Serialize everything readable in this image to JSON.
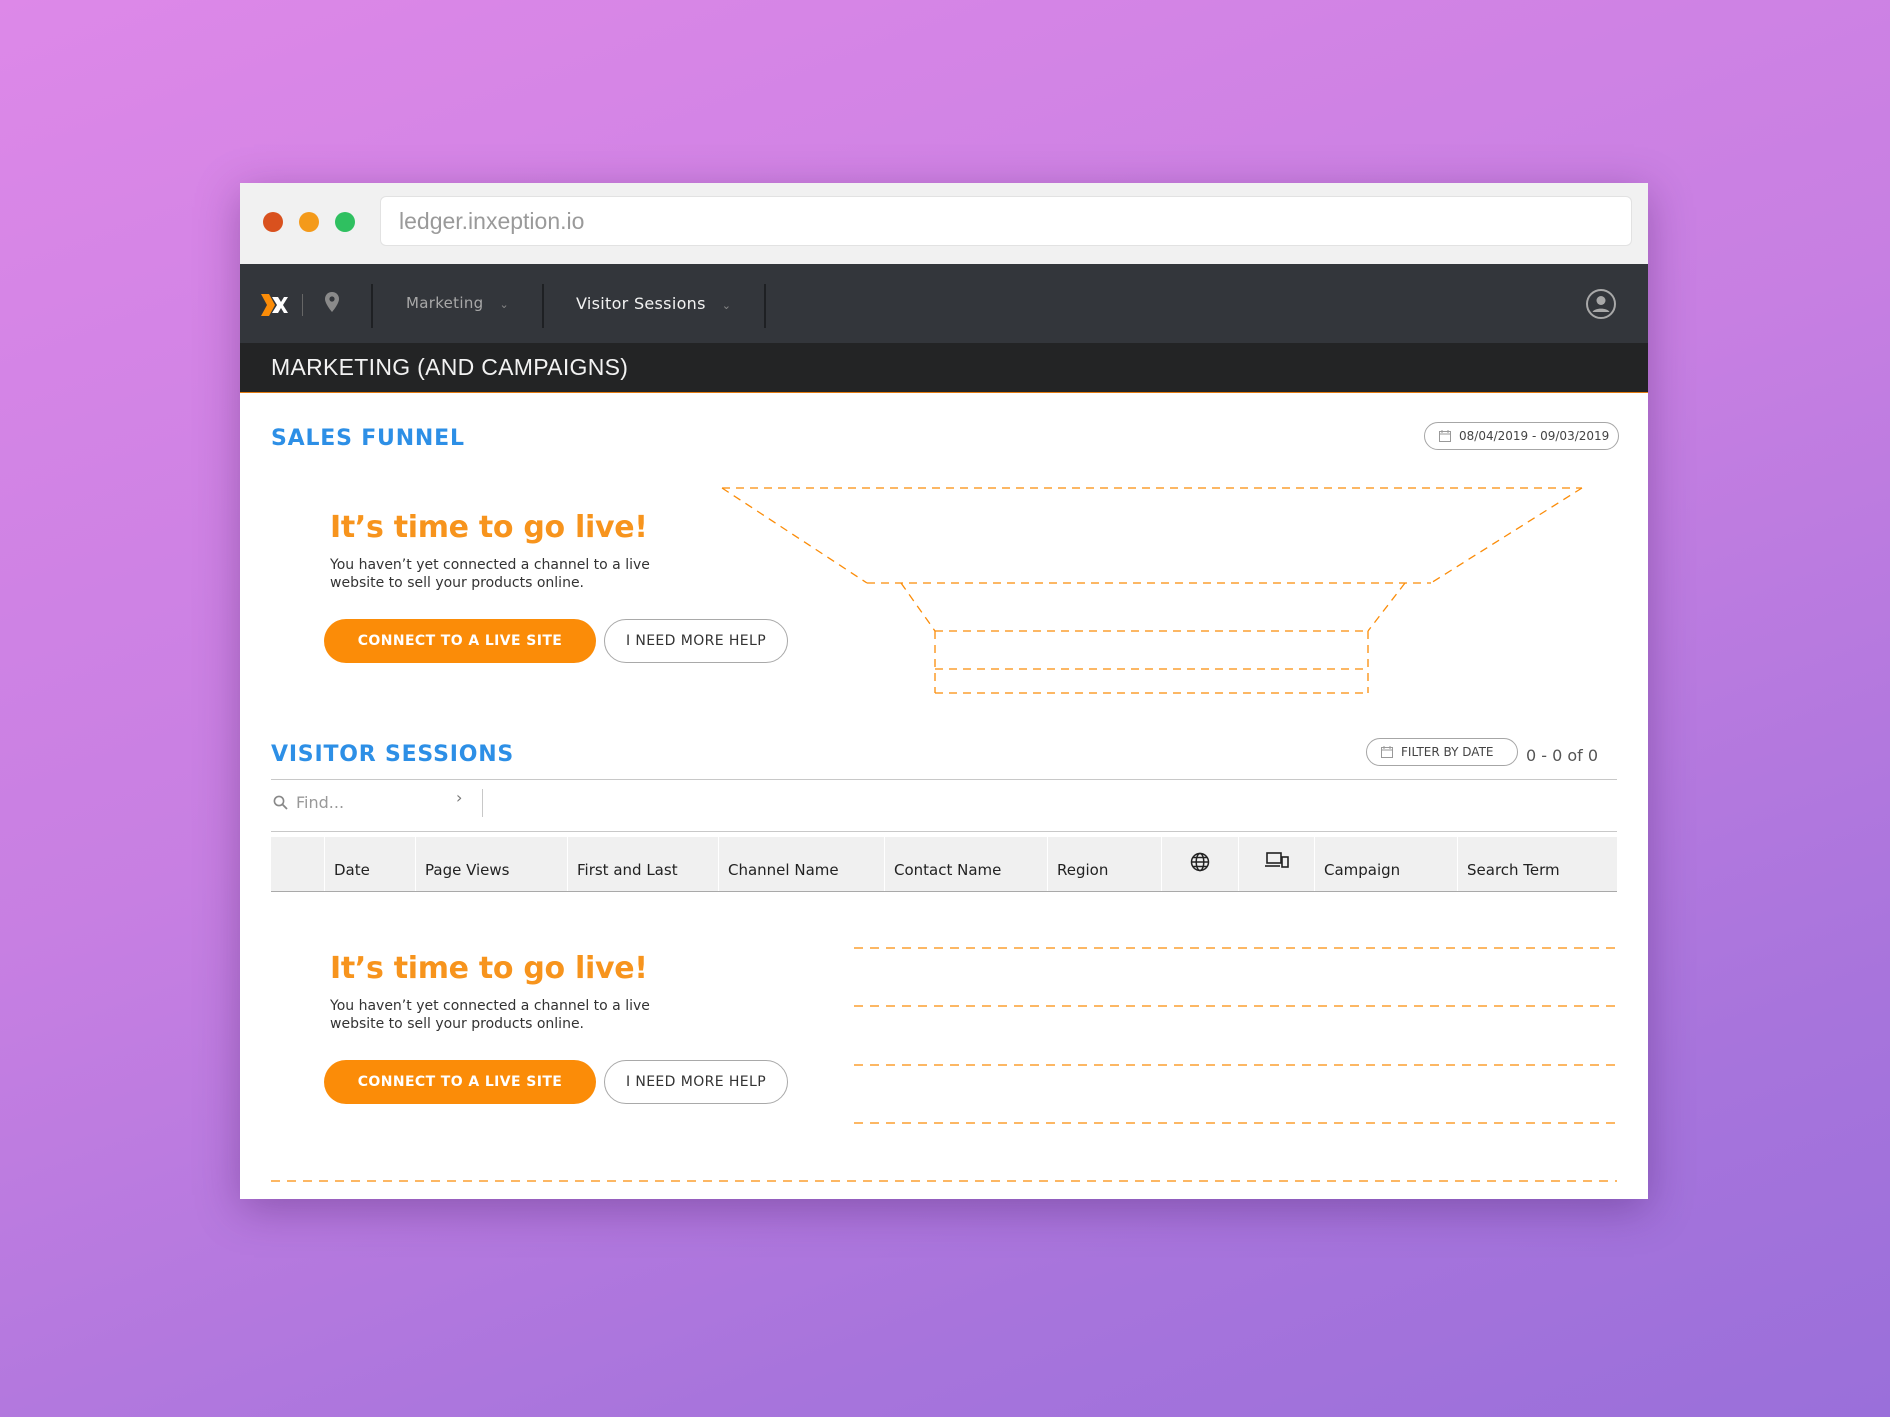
{
  "browser": {
    "url": "ledger.inxeption.io"
  },
  "topnav": {
    "module": "Marketing",
    "page": "Visitor Sessions"
  },
  "header": {
    "title": "MARKETING (AND CAMPAIGNS)"
  },
  "sales_funnel": {
    "title": "SALES FUNNEL",
    "date_range": "08/04/2019 - 09/03/2019",
    "empty_state": {
      "heading": "It’s time to go live!",
      "body": "You haven’t yet connected a channel to a live website to sell your products online.",
      "primary_button": "CONNECT TO A LIVE SITE",
      "secondary_button": "I NEED MORE HELP"
    }
  },
  "visitor_sessions": {
    "title": "VISITOR SESSIONS",
    "filter_button": "FILTER BY DATE",
    "range": "0 - 0 of 0",
    "search_placeholder": "Find...",
    "columns": [
      "Date",
      "Page Views",
      "First and Last",
      "Channel Name",
      "Contact Name",
      "Region",
      "globe-icon",
      "devices-icon",
      "Campaign",
      "Search Term"
    ],
    "empty_state": {
      "heading": "It’s time to go live!",
      "body": "You haven’t yet connected a channel to a live website to sell your products online.",
      "primary_button": "CONNECT TO A LIVE SITE",
      "secondary_button": "I NEED MORE HELP"
    }
  },
  "colors": {
    "accent_orange": "#fb8c08",
    "heading_blue": "#2d8fe6",
    "nav_bg": "#33363b",
    "header_bg": "#232425"
  }
}
